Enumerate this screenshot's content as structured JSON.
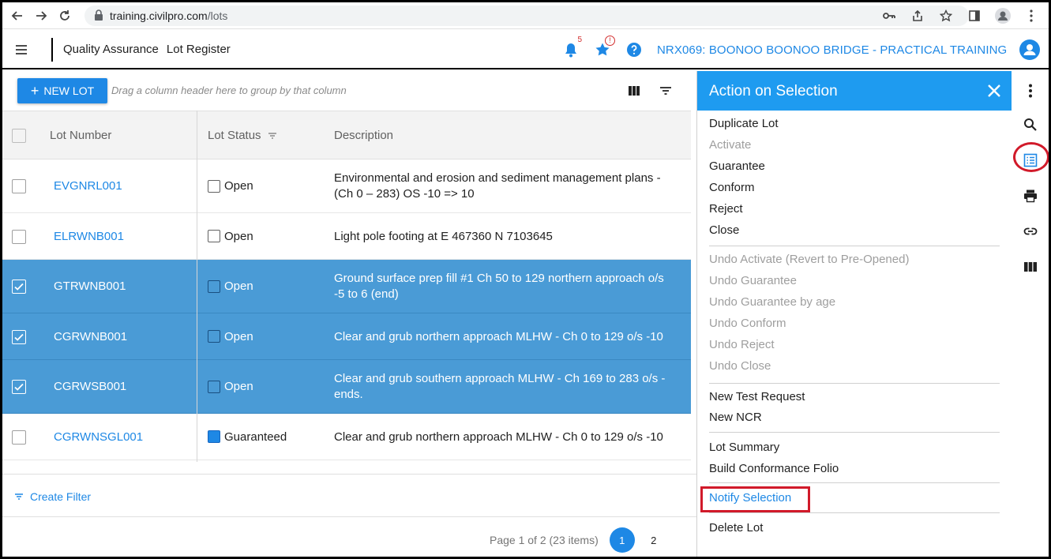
{
  "browser": {
    "url_host": "training.civilpro.com",
    "url_path": "/lots"
  },
  "header": {
    "module": "Quality Assurance",
    "page": "Lot Register",
    "notification_count": "5",
    "star_badge": "!",
    "project": "NRX069: BOONOO BOONOO BRIDGE - PRACTICAL TRAINING"
  },
  "toolbar": {
    "new_lot_label": "NEW LOT",
    "group_hint": "Drag a column header here to group by that column"
  },
  "grid": {
    "columns": [
      "Lot Number",
      "Lot Status",
      "Description"
    ],
    "rows": [
      {
        "lot": "EVGNRL001",
        "status": "Open",
        "desc1": "Environmental and erosion and sediment management plans -",
        "desc2": "(Ch 0 – 283) OS -10 => 10",
        "selected": false,
        "status_color": ""
      },
      {
        "lot": "ELRWNB001",
        "status": "Open",
        "desc1": "Light pole footing at E 467360 N 7103645",
        "desc2": "",
        "selected": false,
        "status_color": ""
      },
      {
        "lot": "GTRWNB001",
        "status": "Open",
        "desc1": "Ground surface prep fill #1 Ch 50 to 129 northern approach o/s",
        "desc2": "-5 to 6 (end)",
        "selected": true,
        "status_color": ""
      },
      {
        "lot": "CGRWNB001",
        "status": "Open",
        "desc1": "Clear and grub northern approach MLHW - Ch 0 to 129 o/s -10",
        "desc2": "",
        "selected": true,
        "status_color": ""
      },
      {
        "lot": "CGRWSB001",
        "status": "Open",
        "desc1": "Clear and grub southern approach MLHW - Ch 169 to 283 o/s -",
        "desc2": "ends.",
        "selected": true,
        "status_color": ""
      },
      {
        "lot": "CGRWNSGL001",
        "status": "Guaranteed",
        "desc1": "Clear and grub northern approach MLHW - Ch 0 to 129 o/s -10",
        "desc2": "",
        "selected": false,
        "status_color": "#1e88e5"
      }
    ]
  },
  "footer": {
    "create_filter": "Create Filter",
    "pager_text": "Page 1 of 2 (23 items)",
    "pages": [
      "1",
      "2"
    ]
  },
  "panel": {
    "title": "Action on Selection",
    "groups": [
      [
        {
          "label": "Duplicate Lot",
          "disabled": false
        },
        {
          "label": "Activate",
          "disabled": true
        },
        {
          "label": "Guarantee",
          "disabled": false
        },
        {
          "label": "Conform",
          "disabled": false
        },
        {
          "label": "Reject",
          "disabled": false
        },
        {
          "label": "Close",
          "disabled": false
        }
      ],
      [
        {
          "label": "Undo Activate (Revert to Pre-Opened)",
          "disabled": true
        },
        {
          "label": "Undo Guarantee",
          "disabled": true
        },
        {
          "label": "Undo Guarantee by age",
          "disabled": true
        },
        {
          "label": "Undo Conform",
          "disabled": true
        },
        {
          "label": "Undo Reject",
          "disabled": true
        },
        {
          "label": "Undo Close",
          "disabled": true
        }
      ],
      [
        {
          "label": "New Test Request",
          "disabled": false
        },
        {
          "label": "New NCR",
          "disabled": false
        }
      ],
      [
        {
          "label": "Lot Summary",
          "disabled": false
        },
        {
          "label": "Build Conformance Folio",
          "disabled": false
        }
      ],
      [
        {
          "label": "Notify Selection",
          "disabled": false,
          "highlight": true
        }
      ],
      [
        {
          "label": "Delete Lot",
          "disabled": false
        }
      ]
    ]
  },
  "colors": {
    "accent": "#1e88e5",
    "panel_header": "#1e9bf0",
    "selected_row": "#4a9bd6",
    "highlight": "#d11a2a"
  }
}
